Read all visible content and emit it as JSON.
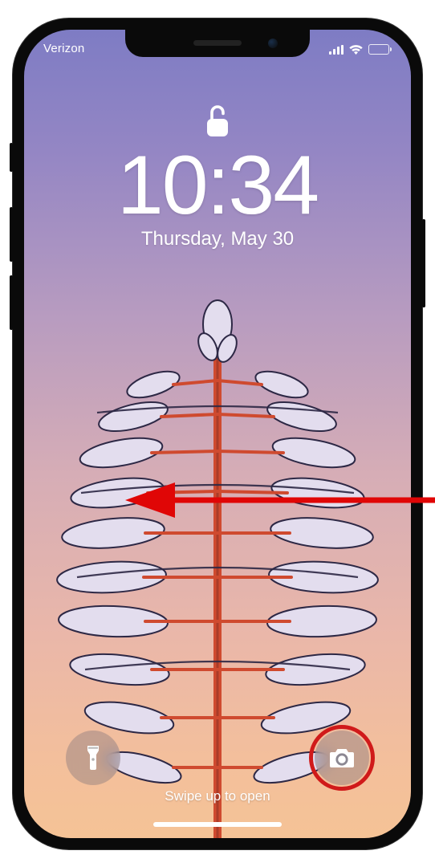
{
  "status": {
    "carrier": "Verizon"
  },
  "lock": {
    "state": "unlocked"
  },
  "clock": {
    "time": "10:34",
    "date": "Thursday, May 30"
  },
  "hint": {
    "swipe_up": "Swipe up to open"
  },
  "quick_actions": {
    "left_icon": "flashlight-icon",
    "right_icon": "camera-icon"
  },
  "annotation": {
    "type": "arrow-left",
    "highlight": "camera-button"
  }
}
